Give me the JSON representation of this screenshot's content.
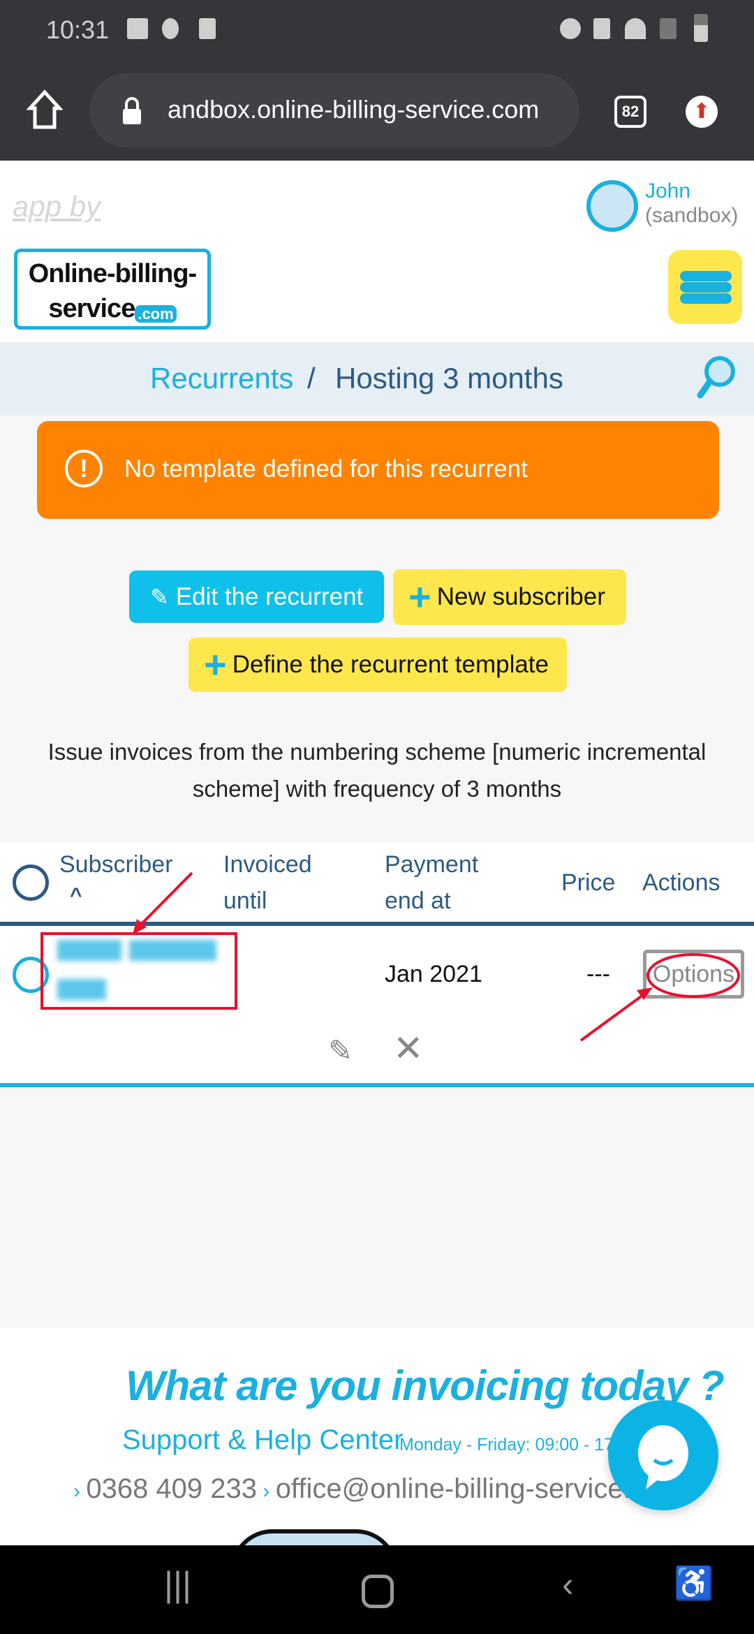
{
  "status_bar": {
    "time": "10:31"
  },
  "browser": {
    "url": "andbox.online-billing-service.com",
    "tab_count": "82"
  },
  "header": {
    "app_by": "app by",
    "logo_line1": "Online-billing-",
    "logo_line2": "service",
    "logo_com": ".com",
    "user_name": "John",
    "user_env": "(sandbox)"
  },
  "breadcrumb": {
    "parent": "Recurrents",
    "separator": "/",
    "current": "Hosting 3 months"
  },
  "alert": {
    "text": "No template defined for this recurrent",
    "color": "#ff8300"
  },
  "actions": {
    "edit": "Edit the recurrent",
    "new_subscriber": "New subscriber",
    "define_template": "Define the recurrent template"
  },
  "description": "Issue invoices from the numbering scheme [numeric incremental scheme] with frequency of 3 months",
  "table": {
    "headers": [
      "Subscriber",
      "Invoiced until",
      "Payment end at",
      "Price",
      "Actions"
    ],
    "rows": [
      {
        "subscriber": "",
        "invoiced_until": "",
        "payment_end_at": "Jan 2021",
        "price": "---",
        "action": "Options"
      }
    ]
  },
  "footer": {
    "slogan": "What are you invoicing today ?",
    "support": "Support & Help Center",
    "hours": "Monday - Friday: 09:00 - 17:",
    "phone": "0368 409 233",
    "email": "office@online-billing-service."
  },
  "colors": {
    "accent": "#1ab0e0",
    "navy": "#2d5a85",
    "yellow": "#fde74c",
    "annotation": "#e8112d"
  }
}
